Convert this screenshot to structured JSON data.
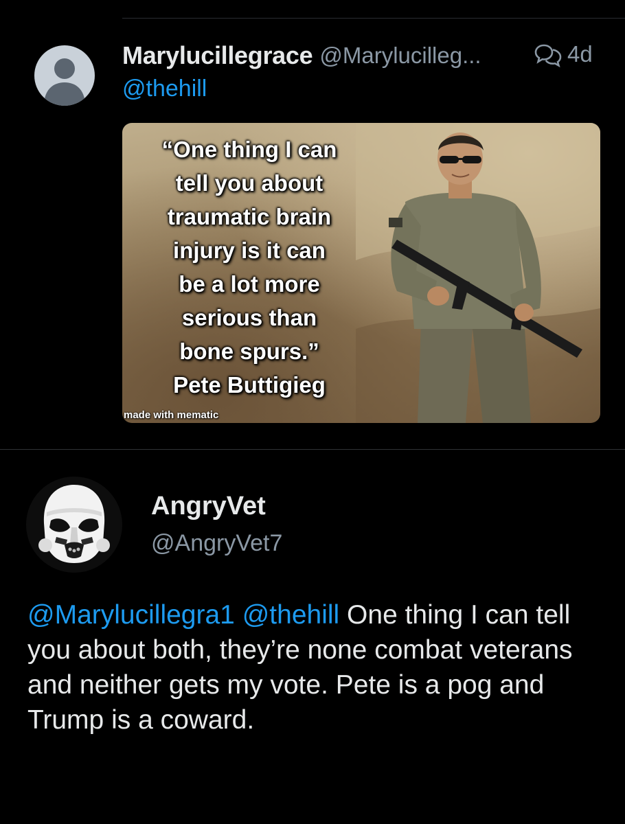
{
  "tweet1": {
    "display_name": "Marylucillegrace",
    "handle": "@Marylucilleg...",
    "time": "4d",
    "reply_to": "@thehill",
    "image": {
      "quote_text": "“One thing I can\ntell you about\ntraumatic brain\ninjury is it can\nbe a lot more\nserious than\nbone spurs.”\nPete Buttigieg",
      "watermark": "made with mematic"
    }
  },
  "tweet2": {
    "display_name": "AngryVet",
    "handle": "@AngryVet7",
    "mentions": [
      "@Marylucillegra1",
      "@thehill"
    ],
    "text": "One thing I can tell you about both, they’re none combat veterans and neither gets my vote. Pete is a pog and Trump is a coward."
  },
  "icons": {
    "default_avatar": "default-avatar-icon",
    "conversation": "conversation-icon",
    "trooper_avatar": "stormtrooper-avatar"
  },
  "colors": {
    "background": "#000000",
    "link": "#1d9bf0",
    "muted": "#8b98a5",
    "text": "#e7e9ea"
  }
}
